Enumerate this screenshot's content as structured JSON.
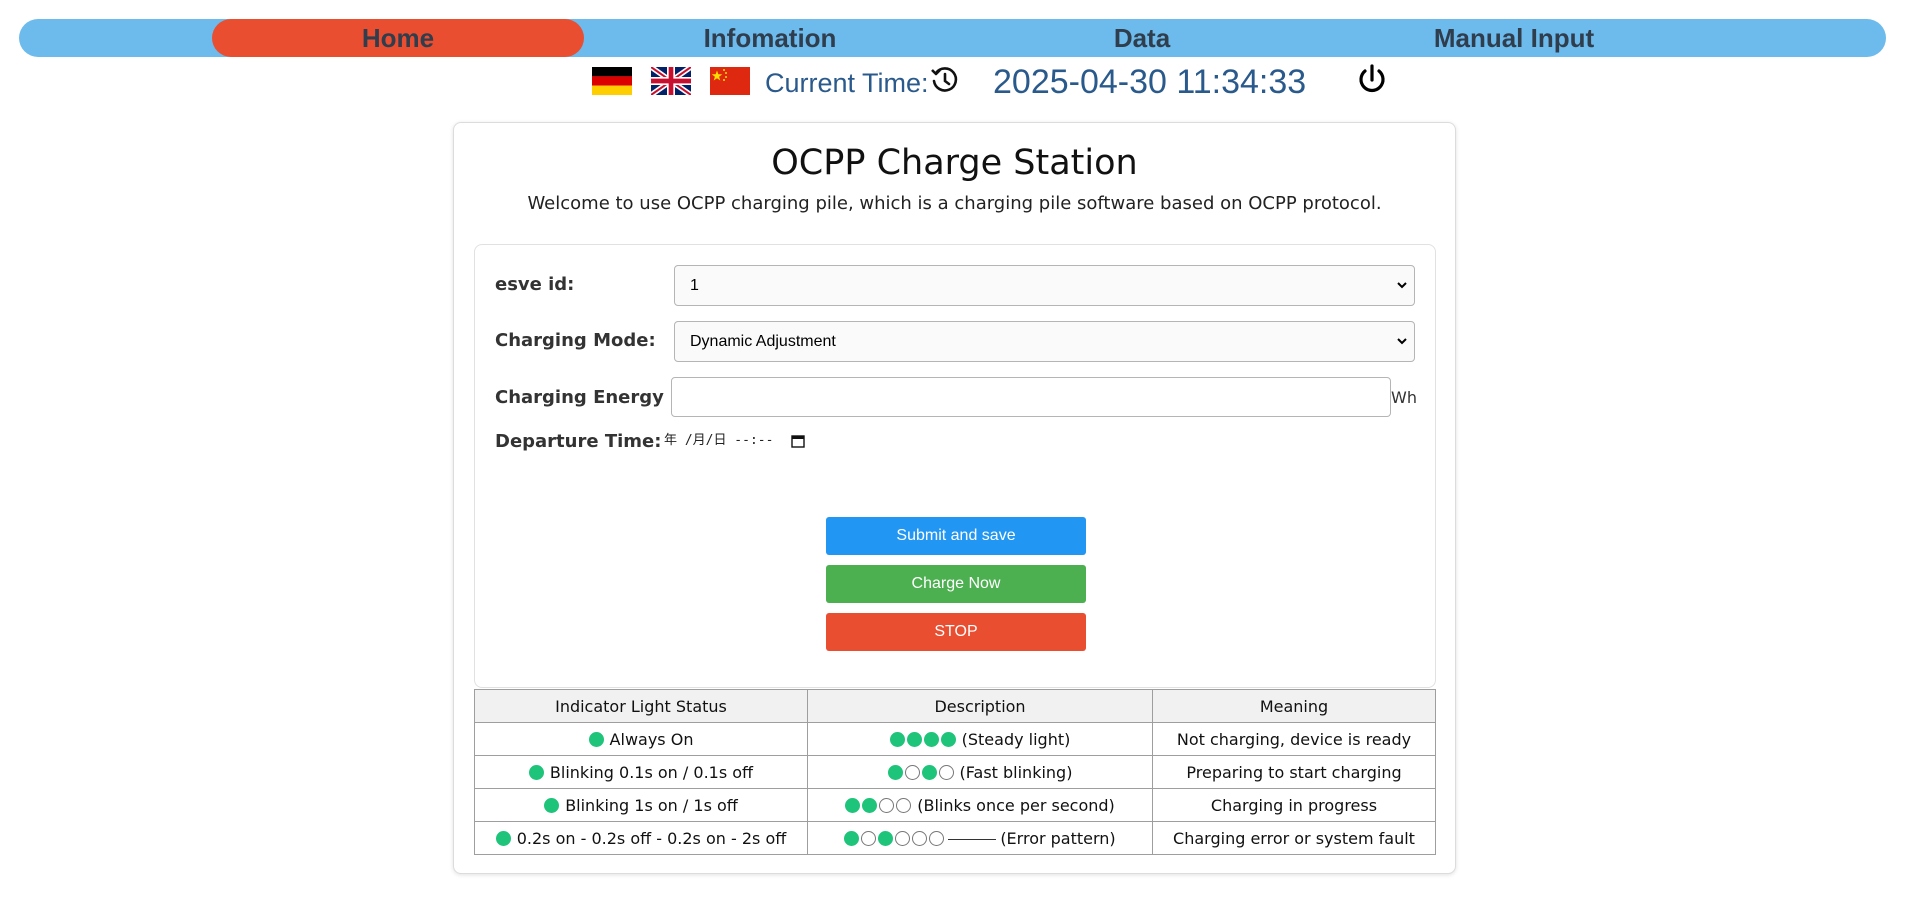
{
  "nav": {
    "items": [
      {
        "label": "Home",
        "active": true
      },
      {
        "label": "Infomation",
        "active": false
      },
      {
        "label": "Data",
        "active": false
      },
      {
        "label": "Manual Input",
        "active": false
      }
    ]
  },
  "header": {
    "languages": [
      "german-flag-icon",
      "uk-flag-icon",
      "china-flag-icon"
    ],
    "current_time_label": "Current Time:",
    "current_time_value": "2025-04-30 11:34:33"
  },
  "page": {
    "title": "OCPP Charge Station",
    "subtitle": "Welcome to use OCPP charging pile, which is a charging pile software based on OCPP protocol."
  },
  "form": {
    "esve_label": "esve id:",
    "esve_value": "1",
    "mode_label": "Charging Mode:",
    "mode_value": "Dynamic Adjustment",
    "energy_label": "Charging Energy",
    "energy_value": "",
    "energy_unit": "Wh",
    "departure_label": "Departure Time:",
    "departure_placeholder": "年 /月/日 --:--"
  },
  "buttons": {
    "submit": "Submit and save",
    "charge": "Charge Now",
    "stop": "STOP"
  },
  "table": {
    "headers": [
      "Indicator Light Status",
      "Description",
      "Meaning"
    ],
    "rows": [
      {
        "status": "Always On",
        "pattern": "1111",
        "tail": false,
        "description": "(Steady light)",
        "meaning": "Not charging, device is ready"
      },
      {
        "status": "Blinking 0.1s on / 0.1s off",
        "pattern": "1010",
        "tail": false,
        "description": "(Fast blinking)",
        "meaning": "Preparing to start charging"
      },
      {
        "status": "Blinking 1s on / 1s off",
        "pattern": "1100",
        "tail": false,
        "description": "(Blinks once per second)",
        "meaning": "Charging in progress"
      },
      {
        "status": "0.2s on - 0.2s off - 0.2s on - 2s off",
        "pattern": "101000",
        "tail": true,
        "description": "(Error pattern)",
        "meaning": "Charging error or system fault"
      }
    ]
  },
  "colors": {
    "nav_bg": "#6cbbec",
    "nav_active": "#e94e31",
    "submit_button": "#2196f3",
    "charge_button": "#4caf50",
    "stop_button": "#e94e31",
    "indicator_on": "#1ec47a",
    "time_text": "#2a5a8c"
  }
}
